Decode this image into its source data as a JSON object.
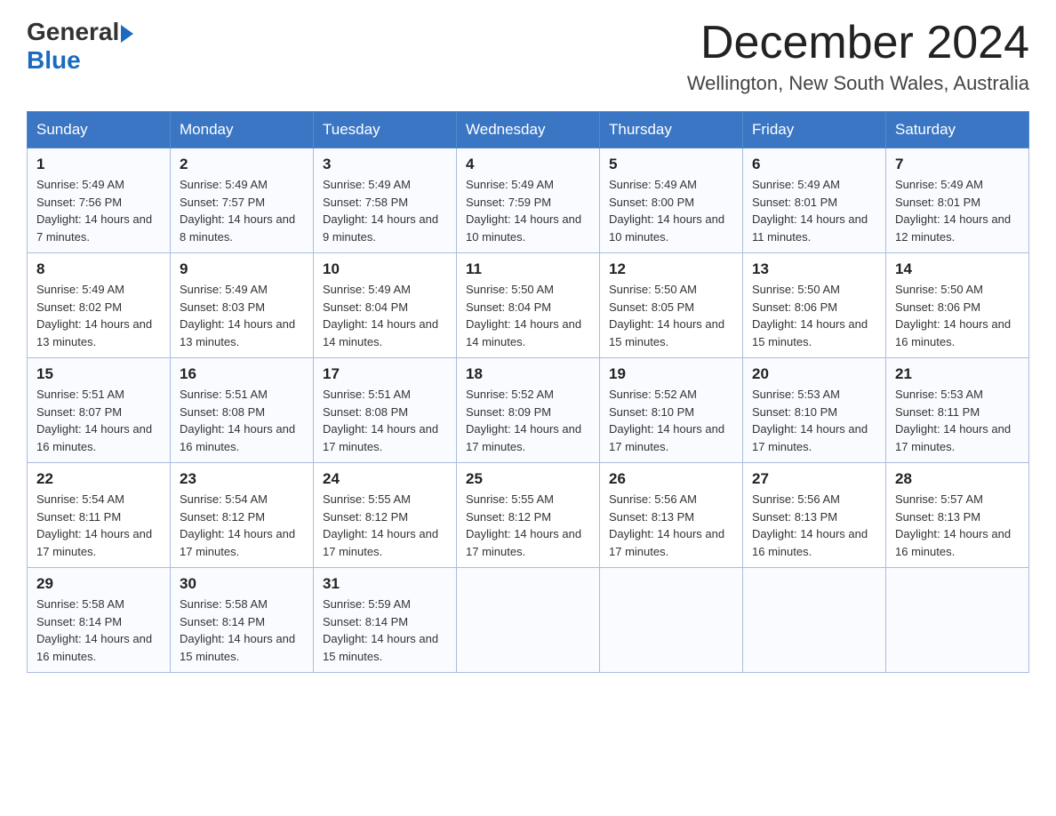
{
  "header": {
    "logo": {
      "general": "General",
      "blue": "Blue"
    },
    "title": "December 2024",
    "subtitle": "Wellington, New South Wales, Australia"
  },
  "columns": [
    "Sunday",
    "Monday",
    "Tuesday",
    "Wednesday",
    "Thursday",
    "Friday",
    "Saturday"
  ],
  "weeks": [
    [
      {
        "day": "1",
        "sunrise": "Sunrise: 5:49 AM",
        "sunset": "Sunset: 7:56 PM",
        "daylight": "Daylight: 14 hours and 7 minutes."
      },
      {
        "day": "2",
        "sunrise": "Sunrise: 5:49 AM",
        "sunset": "Sunset: 7:57 PM",
        "daylight": "Daylight: 14 hours and 8 minutes."
      },
      {
        "day": "3",
        "sunrise": "Sunrise: 5:49 AM",
        "sunset": "Sunset: 7:58 PM",
        "daylight": "Daylight: 14 hours and 9 minutes."
      },
      {
        "day": "4",
        "sunrise": "Sunrise: 5:49 AM",
        "sunset": "Sunset: 7:59 PM",
        "daylight": "Daylight: 14 hours and 10 minutes."
      },
      {
        "day": "5",
        "sunrise": "Sunrise: 5:49 AM",
        "sunset": "Sunset: 8:00 PM",
        "daylight": "Daylight: 14 hours and 10 minutes."
      },
      {
        "day": "6",
        "sunrise": "Sunrise: 5:49 AM",
        "sunset": "Sunset: 8:01 PM",
        "daylight": "Daylight: 14 hours and 11 minutes."
      },
      {
        "day": "7",
        "sunrise": "Sunrise: 5:49 AM",
        "sunset": "Sunset: 8:01 PM",
        "daylight": "Daylight: 14 hours and 12 minutes."
      }
    ],
    [
      {
        "day": "8",
        "sunrise": "Sunrise: 5:49 AM",
        "sunset": "Sunset: 8:02 PM",
        "daylight": "Daylight: 14 hours and 13 minutes."
      },
      {
        "day": "9",
        "sunrise": "Sunrise: 5:49 AM",
        "sunset": "Sunset: 8:03 PM",
        "daylight": "Daylight: 14 hours and 13 minutes."
      },
      {
        "day": "10",
        "sunrise": "Sunrise: 5:49 AM",
        "sunset": "Sunset: 8:04 PM",
        "daylight": "Daylight: 14 hours and 14 minutes."
      },
      {
        "day": "11",
        "sunrise": "Sunrise: 5:50 AM",
        "sunset": "Sunset: 8:04 PM",
        "daylight": "Daylight: 14 hours and 14 minutes."
      },
      {
        "day": "12",
        "sunrise": "Sunrise: 5:50 AM",
        "sunset": "Sunset: 8:05 PM",
        "daylight": "Daylight: 14 hours and 15 minutes."
      },
      {
        "day": "13",
        "sunrise": "Sunrise: 5:50 AM",
        "sunset": "Sunset: 8:06 PM",
        "daylight": "Daylight: 14 hours and 15 minutes."
      },
      {
        "day": "14",
        "sunrise": "Sunrise: 5:50 AM",
        "sunset": "Sunset: 8:06 PM",
        "daylight": "Daylight: 14 hours and 16 minutes."
      }
    ],
    [
      {
        "day": "15",
        "sunrise": "Sunrise: 5:51 AM",
        "sunset": "Sunset: 8:07 PM",
        "daylight": "Daylight: 14 hours and 16 minutes."
      },
      {
        "day": "16",
        "sunrise": "Sunrise: 5:51 AM",
        "sunset": "Sunset: 8:08 PM",
        "daylight": "Daylight: 14 hours and 16 minutes."
      },
      {
        "day": "17",
        "sunrise": "Sunrise: 5:51 AM",
        "sunset": "Sunset: 8:08 PM",
        "daylight": "Daylight: 14 hours and 17 minutes."
      },
      {
        "day": "18",
        "sunrise": "Sunrise: 5:52 AM",
        "sunset": "Sunset: 8:09 PM",
        "daylight": "Daylight: 14 hours and 17 minutes."
      },
      {
        "day": "19",
        "sunrise": "Sunrise: 5:52 AM",
        "sunset": "Sunset: 8:10 PM",
        "daylight": "Daylight: 14 hours and 17 minutes."
      },
      {
        "day": "20",
        "sunrise": "Sunrise: 5:53 AM",
        "sunset": "Sunset: 8:10 PM",
        "daylight": "Daylight: 14 hours and 17 minutes."
      },
      {
        "day": "21",
        "sunrise": "Sunrise: 5:53 AM",
        "sunset": "Sunset: 8:11 PM",
        "daylight": "Daylight: 14 hours and 17 minutes."
      }
    ],
    [
      {
        "day": "22",
        "sunrise": "Sunrise: 5:54 AM",
        "sunset": "Sunset: 8:11 PM",
        "daylight": "Daylight: 14 hours and 17 minutes."
      },
      {
        "day": "23",
        "sunrise": "Sunrise: 5:54 AM",
        "sunset": "Sunset: 8:12 PM",
        "daylight": "Daylight: 14 hours and 17 minutes."
      },
      {
        "day": "24",
        "sunrise": "Sunrise: 5:55 AM",
        "sunset": "Sunset: 8:12 PM",
        "daylight": "Daylight: 14 hours and 17 minutes."
      },
      {
        "day": "25",
        "sunrise": "Sunrise: 5:55 AM",
        "sunset": "Sunset: 8:12 PM",
        "daylight": "Daylight: 14 hours and 17 minutes."
      },
      {
        "day": "26",
        "sunrise": "Sunrise: 5:56 AM",
        "sunset": "Sunset: 8:13 PM",
        "daylight": "Daylight: 14 hours and 17 minutes."
      },
      {
        "day": "27",
        "sunrise": "Sunrise: 5:56 AM",
        "sunset": "Sunset: 8:13 PM",
        "daylight": "Daylight: 14 hours and 16 minutes."
      },
      {
        "day": "28",
        "sunrise": "Sunrise: 5:57 AM",
        "sunset": "Sunset: 8:13 PM",
        "daylight": "Daylight: 14 hours and 16 minutes."
      }
    ],
    [
      {
        "day": "29",
        "sunrise": "Sunrise: 5:58 AM",
        "sunset": "Sunset: 8:14 PM",
        "daylight": "Daylight: 14 hours and 16 minutes."
      },
      {
        "day": "30",
        "sunrise": "Sunrise: 5:58 AM",
        "sunset": "Sunset: 8:14 PM",
        "daylight": "Daylight: 14 hours and 15 minutes."
      },
      {
        "day": "31",
        "sunrise": "Sunrise: 5:59 AM",
        "sunset": "Sunset: 8:14 PM",
        "daylight": "Daylight: 14 hours and 15 minutes."
      },
      null,
      null,
      null,
      null
    ]
  ]
}
